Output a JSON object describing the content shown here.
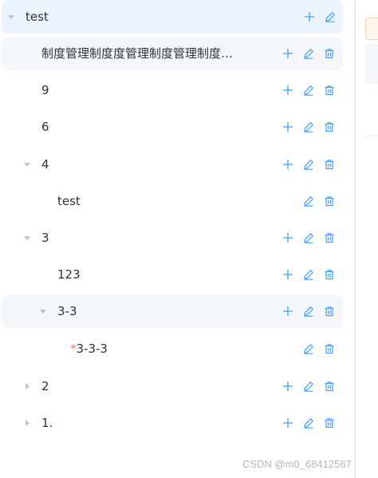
{
  "tree": {
    "nodes": [
      {
        "label": "test",
        "expanded": true,
        "has_children": true,
        "actions": [
          "add",
          "edit"
        ]
      },
      {
        "label": "制度管理制度度管理制度管理制度管理制度管理",
        "has_children": false,
        "actions": [
          "add",
          "edit",
          "delete"
        ]
      },
      {
        "label": "9",
        "has_children": false,
        "actions": [
          "add",
          "edit",
          "delete"
        ]
      },
      {
        "label": "6",
        "has_children": false,
        "actions": [
          "add",
          "edit",
          "delete"
        ]
      },
      {
        "label": "4",
        "expanded": true,
        "has_children": true,
        "actions": [
          "add",
          "edit",
          "delete"
        ]
      },
      {
        "label": "test",
        "has_children": false,
        "actions": [
          "edit",
          "delete"
        ]
      },
      {
        "label": "3",
        "expanded": true,
        "has_children": true,
        "actions": [
          "add",
          "edit",
          "delete"
        ]
      },
      {
        "label": "123",
        "has_children": false,
        "actions": [
          "add",
          "edit",
          "delete"
        ]
      },
      {
        "label": "3-3",
        "expanded": true,
        "has_children": true,
        "actions": [
          "add",
          "edit",
          "delete"
        ]
      },
      {
        "label": "3-3-3",
        "required_mark": "*",
        "has_children": false,
        "actions": [
          "edit",
          "delete"
        ]
      },
      {
        "label": "2",
        "expanded": false,
        "has_children": true,
        "actions": [
          "add",
          "edit",
          "delete"
        ]
      },
      {
        "label": "1.",
        "expanded": false,
        "has_children": true,
        "actions": [
          "add",
          "edit",
          "delete"
        ]
      }
    ]
  },
  "icons": {
    "add": "plus-icon",
    "edit": "edit-pen-icon",
    "delete": "trash-icon",
    "caret_expanded": "caret-down-icon",
    "caret_collapsed": "caret-right-icon"
  },
  "colors": {
    "primary": "#409eff",
    "required": "#f56c6c",
    "caret": "#c0c4cc",
    "text": "#303133"
  },
  "watermark": "CSDN @m0_68412567"
}
